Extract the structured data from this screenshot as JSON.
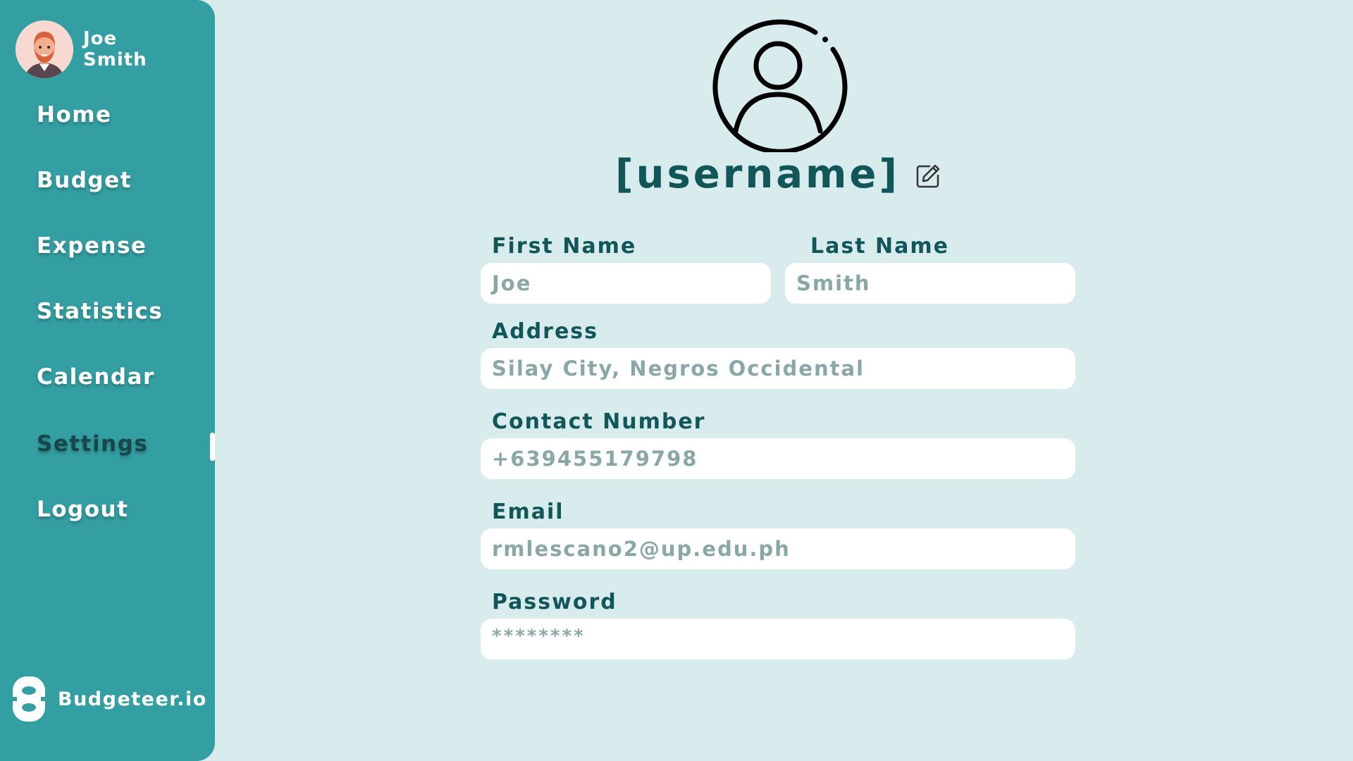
{
  "sidebar": {
    "user": {
      "first": "Joe",
      "last": "Smith",
      "avatar_icon": "avatar-man-icon"
    },
    "nav": [
      {
        "label": "Home"
      },
      {
        "label": "Budget"
      },
      {
        "label": "Expense"
      },
      {
        "label": "Statistics"
      },
      {
        "label": "Calendar"
      },
      {
        "label": "Settings",
        "active": true
      },
      {
        "label": "Logout"
      }
    ],
    "brand": {
      "name": "Budgeteer.io",
      "logo_icon": "budgeteer-logo-icon"
    },
    "colors": {
      "background": "#339fa2",
      "active_text": "#17474a"
    }
  },
  "profile": {
    "avatar_icon": "user-circle-icon",
    "username": "[username]",
    "edit_icon": "edit-icon"
  },
  "form": {
    "first_name": {
      "label": "First Name",
      "value": "Joe"
    },
    "last_name": {
      "label": "Last Name",
      "value": "Smith"
    },
    "address": {
      "label": "Address",
      "value": "Silay City, Negros Occidental"
    },
    "contact": {
      "label": "Contact Number",
      "value": "+639455179798"
    },
    "email": {
      "label": "Email",
      "value": "rmlescano2@up.edu.ph"
    },
    "password": {
      "label": "Password",
      "value": "********"
    }
  },
  "colors": {
    "page_background": "#d8eced",
    "heading": "#115658",
    "input_text": "#8aa7a8"
  }
}
